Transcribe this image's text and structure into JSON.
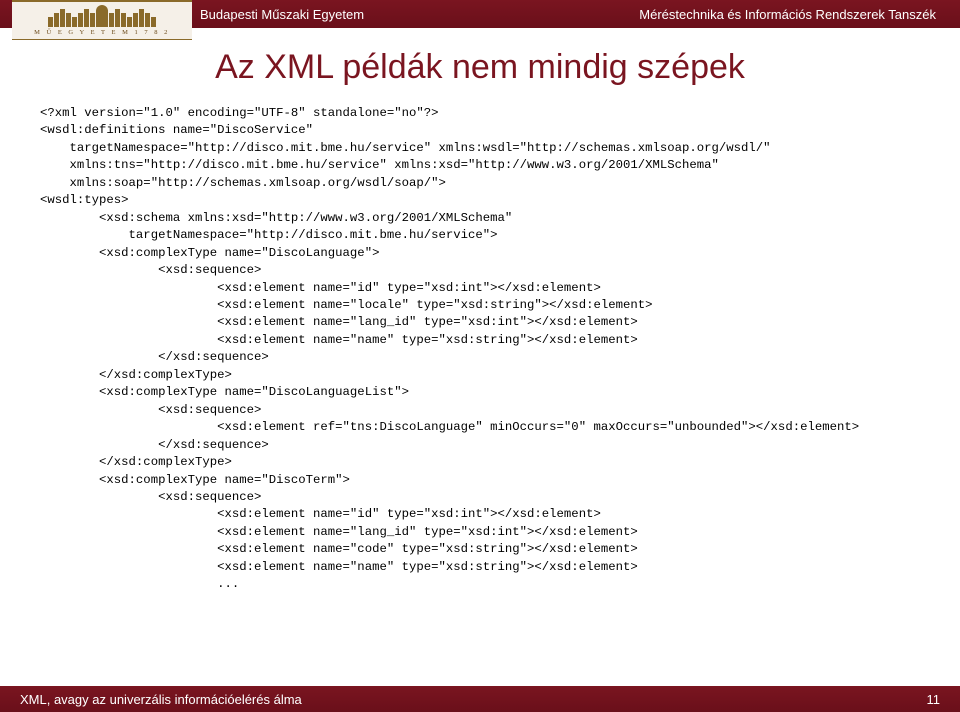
{
  "header": {
    "left": "Budapesti Műszaki Egyetem",
    "right": "Méréstechnika és Információs Rendszerek Tanszék",
    "logo_text": "M Ű E G Y E T E M   1 7 8 2"
  },
  "title": "Az XML példák nem mindig szépek",
  "code_lines": [
    "<?xml version=\"1.0\" encoding=\"UTF-8\" standalone=\"no\"?>",
    "<wsdl:definitions name=\"DiscoService\"",
    "    targetNamespace=\"http://disco.mit.bme.hu/service\" xmlns:wsdl=\"http://schemas.xmlsoap.org/wsdl/\"",
    "    xmlns:tns=\"http://disco.mit.bme.hu/service\" xmlns:xsd=\"http://www.w3.org/2001/XMLSchema\"",
    "    xmlns:soap=\"http://schemas.xmlsoap.org/wsdl/soap/\">",
    "<wsdl:types>",
    "        <xsd:schema xmlns:xsd=\"http://www.w3.org/2001/XMLSchema\"",
    "            targetNamespace=\"http://disco.mit.bme.hu/service\">",
    "        <xsd:complexType name=\"DiscoLanguage\">",
    "                <xsd:sequence>",
    "                        <xsd:element name=\"id\" type=\"xsd:int\"></xsd:element>",
    "                        <xsd:element name=\"locale\" type=\"xsd:string\"></xsd:element>",
    "                        <xsd:element name=\"lang_id\" type=\"xsd:int\"></xsd:element>",
    "                        <xsd:element name=\"name\" type=\"xsd:string\"></xsd:element>",
    "                </xsd:sequence>",
    "        </xsd:complexType>",
    "        <xsd:complexType name=\"DiscoLanguageList\">",
    "                <xsd:sequence>",
    "                        <xsd:element ref=\"tns:DiscoLanguage\" minOccurs=\"0\" maxOccurs=\"unbounded\"></xsd:element>",
    "                </xsd:sequence>",
    "        </xsd:complexType>",
    "        <xsd:complexType name=\"DiscoTerm\">",
    "                <xsd:sequence>",
    "                        <xsd:element name=\"id\" type=\"xsd:int\"></xsd:element>",
    "                        <xsd:element name=\"lang_id\" type=\"xsd:int\"></xsd:element>",
    "                        <xsd:element name=\"code\" type=\"xsd:string\"></xsd:element>",
    "                        <xsd:element name=\"name\" type=\"xsd:string\"></xsd:element>",
    "                        ..."
  ],
  "footer": {
    "left": "XML, avagy az univerzális információelérés álma",
    "page": "11"
  }
}
